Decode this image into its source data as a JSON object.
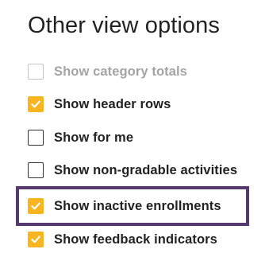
{
  "panel": {
    "title": "Other view options"
  },
  "options": [
    {
      "label": "Show category totals",
      "checked": false,
      "disabled": true
    },
    {
      "label": "Show header rows",
      "checked": true,
      "disabled": false
    },
    {
      "label": "Show for me",
      "checked": false,
      "disabled": false
    },
    {
      "label": "Show non-gradable activities",
      "checked": false,
      "disabled": false
    },
    {
      "label": "Show inactive enrollments",
      "checked": true,
      "disabled": false
    },
    {
      "label": "Show feedback indicators",
      "checked": true,
      "disabled": false
    }
  ],
  "colors": {
    "checkbox_checked": "#f8b520",
    "highlight_frame": "#563a6f"
  },
  "icons": {
    "checkmark": "check-icon"
  }
}
